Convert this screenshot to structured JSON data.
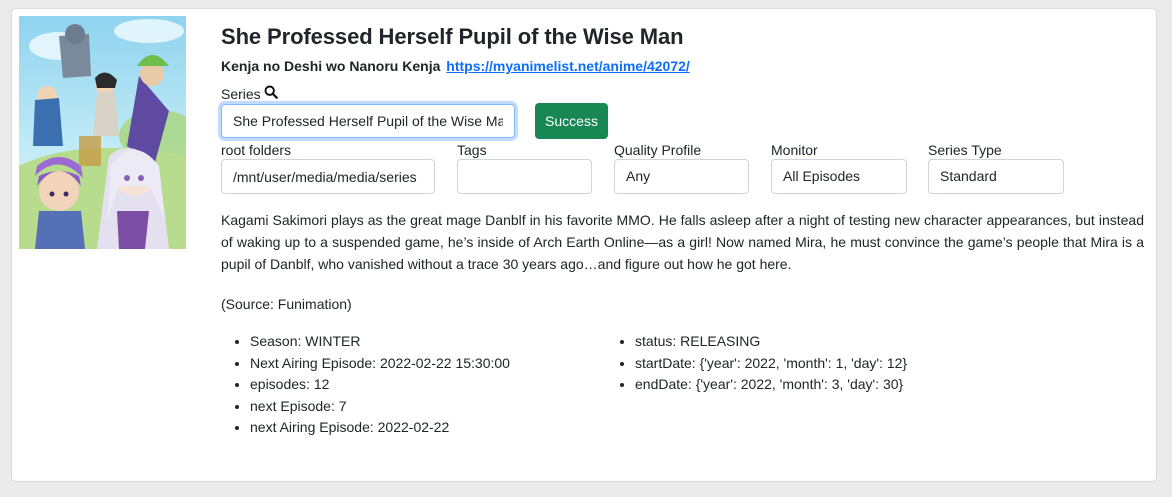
{
  "anime": {
    "title": "She Professed Herself Pupil of the Wise Man",
    "romaji": "Kenja no Deshi wo Nanoru Kenja",
    "link": "https://myanimelist.net/anime/42072/",
    "cover_alt": "She Professed Herself Pupil of the Wise Man cover art"
  },
  "series_search": {
    "label": "Series",
    "value": "She Professed Herself Pupil of the Wise Man",
    "button_label": "Success"
  },
  "fields": {
    "root_folders": {
      "label": "root folders",
      "value": "/mnt/user/media/media/series"
    },
    "tags": {
      "label": "Tags",
      "value": ""
    },
    "quality_profile": {
      "label": "Quality Profile",
      "value": "Any"
    },
    "monitor": {
      "label": "Monitor",
      "value": "All Episodes"
    },
    "series_type": {
      "label": "Series Type",
      "value": "Standard"
    }
  },
  "synopsis": "Kagami Sakimori plays as the great mage Danblf in his favorite MMO. He falls asleep after a night of testing new character appearances, but instead of waking up to a suspended game, he’s inside of Arch Earth Online—as a girl! Now named Mira, he must convince the game’s people that Mira is a pupil of Danblf, who vanished without a trace 30 years ago…and figure out how he got here.",
  "source": "(Source: Funimation)",
  "info_left": [
    "Season: WINTER",
    "Next Airing Episode: 2022-02-22 15:30:00",
    "episodes: 12",
    "next Episode: 7",
    "next Airing Episode: 2022-02-22"
  ],
  "info_right": [
    "status: RELEASING",
    "startDate: {'year': 2022, 'month': 1, 'day': 12}",
    "endDate: {'year': 2022, 'month': 3, 'day': 30}"
  ],
  "colors": {
    "success": "#198754",
    "link": "#0d6efd",
    "focus_border": "#86b7fe"
  },
  "icons": {
    "search": "search-icon"
  }
}
